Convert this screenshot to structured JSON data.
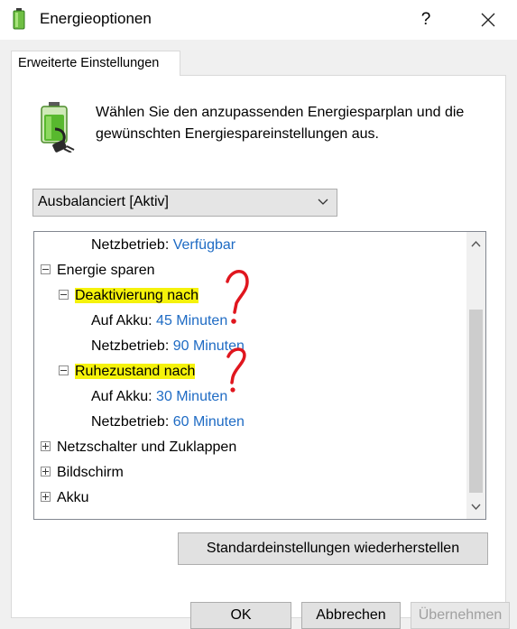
{
  "window": {
    "title": "Energieoptionen",
    "help_glyph": "?",
    "icons": {
      "app": "battery-power-icon",
      "close": "close-icon"
    }
  },
  "tab": {
    "label": "Erweiterte Einstellungen"
  },
  "intro": {
    "icon": "power-plan-icon",
    "text": "Wählen Sie den anzupassenden Energiesparplan und die gewünschten Energiespareinstellungen aus."
  },
  "plan_select": {
    "value": "Ausbalanciert [Aktiv]",
    "icon": "chevron-down-icon"
  },
  "tree": {
    "row0": {
      "label": "Netzbetrieb:",
      "value": "Verfügbar"
    },
    "energy_saving": {
      "label": "Energie sparen"
    },
    "sleep_after": {
      "label": "Deaktivierung nach",
      "battery": {
        "label": "Auf Akku:",
        "value": "45 Minuten"
      },
      "ac": {
        "label": "Netzbetrieb:",
        "value": "90 Minuten"
      }
    },
    "hibernate_after": {
      "label": "Ruhezustand nach",
      "battery": {
        "label": "Auf Akku:",
        "value": "30 Minuten"
      },
      "ac": {
        "label": "Netzbetrieb:",
        "value": "60 Minuten"
      }
    },
    "power_buttons": {
      "label": "Netzschalter und Zuklappen"
    },
    "display": {
      "label": "Bildschirm"
    },
    "battery": {
      "label": "Akku"
    }
  },
  "buttons": {
    "restore_defaults": "Standardeinstellungen wiederherstellen",
    "ok": "OK",
    "cancel": "Abbrechen",
    "apply": "Übernehmen"
  },
  "colors": {
    "link": "#1e6bc4",
    "highlight": "#f5f20b",
    "annotation": "#e0161e"
  }
}
